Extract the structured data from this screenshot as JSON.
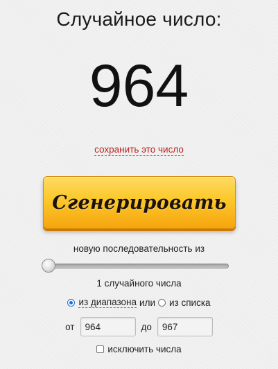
{
  "header": {
    "title": "Случайное число:"
  },
  "result": {
    "number": "964",
    "save_link": "сохранить это число"
  },
  "generate_button": {
    "label": "Сгенерировать"
  },
  "sequence": {
    "label": "новую последовательность из",
    "slider_value": 1,
    "count_label": "1 случайного числа"
  },
  "mode": {
    "option_range": "из диапазона",
    "separator": "или",
    "option_list": "из списка",
    "selected": "range"
  },
  "range": {
    "from_label": "от",
    "from_value": "964",
    "to_label": "до",
    "to_value": "967"
  },
  "exclude": {
    "label": "исключить числа",
    "checked": false
  },
  "colors": {
    "button_top": "#fedb63",
    "button_bottom": "#f6a50f",
    "link_red": "#b22222",
    "radio_blue": "#1d6fd6"
  }
}
